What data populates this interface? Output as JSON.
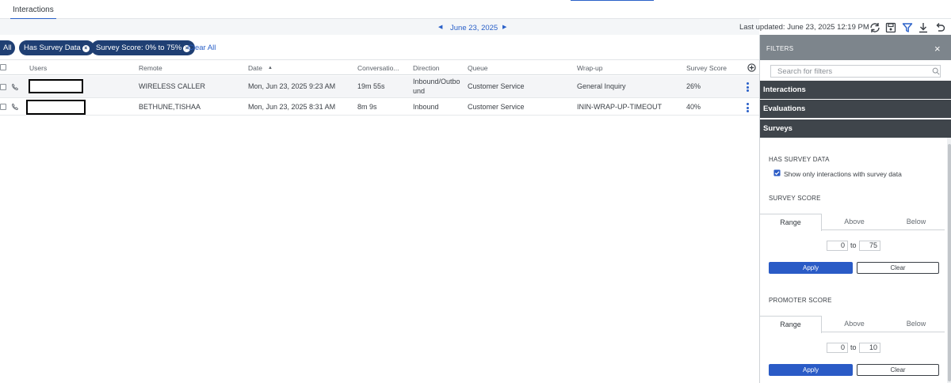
{
  "tabs": {
    "interactions": "Interactions"
  },
  "datebar": {
    "date": "June 23, 2025",
    "prev": "◀",
    "next": "▶"
  },
  "toolbar": {
    "last_updated": "Last updated: June 23, 2025 12:19 PM",
    "icons": [
      "refresh-icon",
      "save-icon",
      "filter-icon",
      "download-icon",
      "undo-icon"
    ]
  },
  "pills": {
    "all": "All",
    "survey_data": "Has Survey Data",
    "survey_score": "Survey Score: 0% to 75%",
    "clear_all": "Clear All"
  },
  "table": {
    "headers": {
      "users": "Users",
      "remote": "Remote",
      "date": "Date",
      "date_sort": "▲",
      "conversation": "Conversatio...",
      "direction": "Direction",
      "queue": "Queue",
      "wrapup": "Wrap-up",
      "survey_score": "Survey Score"
    },
    "rows": [
      {
        "remote": "WIRELESS CALLER",
        "date": "Mon, Jun 23, 2025 9:23 AM",
        "duration": "19m 55s",
        "direction_line1": "Inbound/Outbo",
        "direction_line2": "und",
        "queue": "Customer Service",
        "wrapup": "General Inquiry",
        "score": "26%"
      },
      {
        "remote": "BETHUNE,TISHAA",
        "date": "Mon, Jun 23, 2025 8:31 AM",
        "duration": "8m 9s",
        "direction_line1": "Inbound",
        "direction_line2": "",
        "queue": "Customer Service",
        "wrapup": "ININ-WRAP-UP-TIMEOUT",
        "score": "40%"
      }
    ]
  },
  "filters": {
    "title": "FILTERS",
    "close": "×",
    "search_placeholder": "Search for filters",
    "sections": {
      "interactions": "Interactions",
      "evaluations": "Evaluations",
      "surveys": "Surveys"
    },
    "has_survey": {
      "label": "HAS SURVEY DATA",
      "checkbox": "Show only interactions with survey data",
      "checked": true
    },
    "survey_score": {
      "label": "SURVEY SCORE",
      "tabs": [
        "Range",
        "Above",
        "Below"
      ],
      "from": "0",
      "to_word": "to",
      "to": "75",
      "apply": "Apply",
      "clear": "Clear"
    },
    "promoter_score": {
      "label": "PROMOTER SCORE",
      "tabs": [
        "Range",
        "Above",
        "Below"
      ],
      "from": "0",
      "to_word": "to",
      "to": "10",
      "apply": "Apply",
      "clear": "Clear"
    }
  },
  "colors": {
    "accent": "#2a60c8",
    "pill": "#1f3f73",
    "section": "#3f454b",
    "panel_header": "#7d858c"
  }
}
